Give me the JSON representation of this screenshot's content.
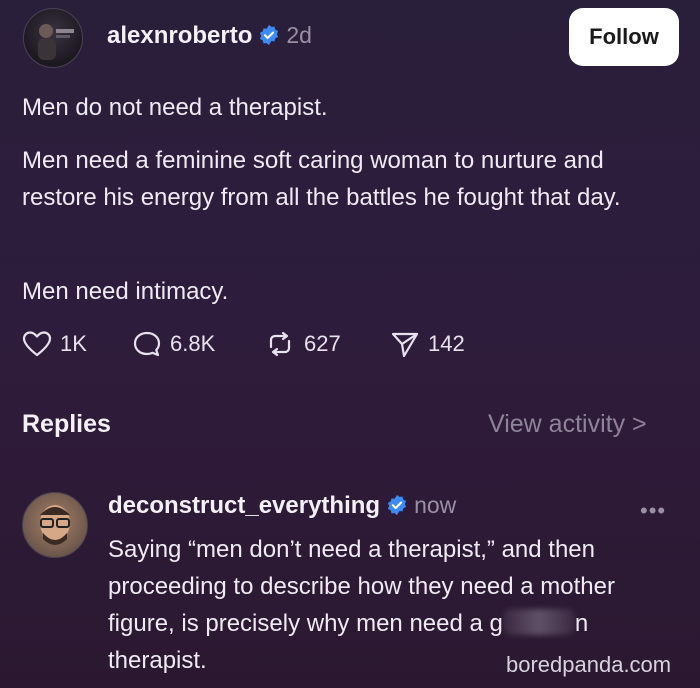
{
  "post": {
    "username": "alexnroberto",
    "time": "2d",
    "follow_label": "Follow",
    "paragraphs": [
      "Men do not need a therapist.",
      "Men need a feminine soft caring woman to nurture and restore his energy from all the battles he fought that day.",
      "Men need intimacy."
    ],
    "stats": {
      "likes": "1K",
      "comments": "6.8K",
      "reposts": "627",
      "shares": "142"
    }
  },
  "replies_section": {
    "title": "Replies",
    "view_activity": "View activity >"
  },
  "reply": {
    "username": "deconstruct_everything",
    "time": "now",
    "text_before": "Saying “men don’t need a therapist,” and then proceeding to describe how they need a mother figure, is precisely why men need a g",
    "text_after": "n therapist."
  },
  "watermark": "boredpanda.com",
  "colors": {
    "verified": "#3d8bf2",
    "background": "#2c1d3c",
    "muted": "#9a90a4"
  }
}
